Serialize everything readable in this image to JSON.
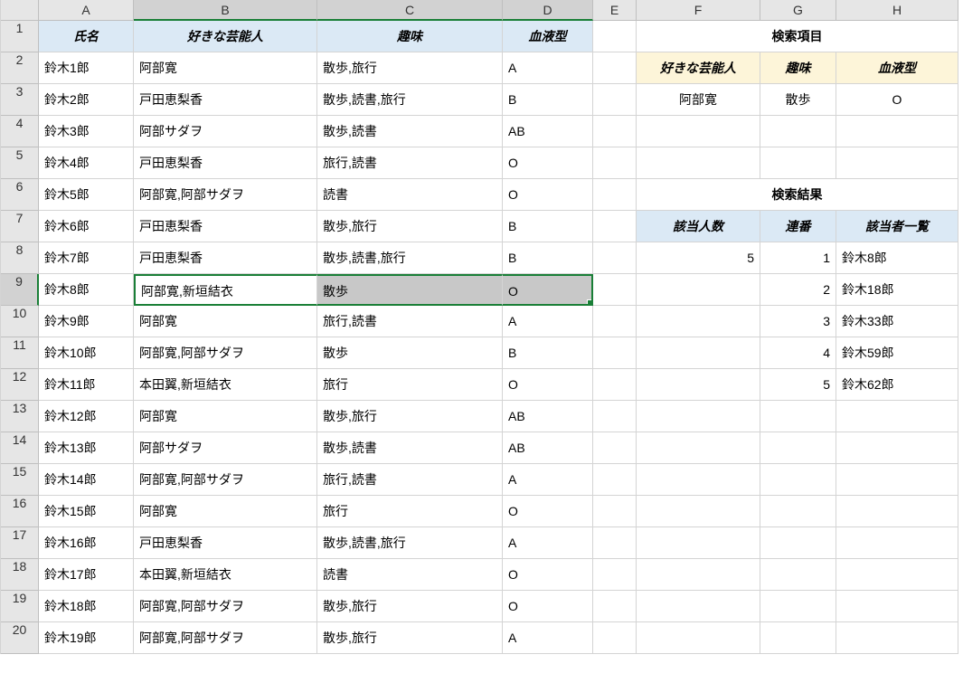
{
  "cols": [
    "A",
    "B",
    "C",
    "D",
    "E",
    "F",
    "G",
    "H"
  ],
  "rows": [
    "1",
    "2",
    "3",
    "4",
    "5",
    "6",
    "7",
    "8",
    "9",
    "10",
    "11",
    "12",
    "13",
    "14",
    "15",
    "16",
    "17",
    "18",
    "19",
    "20"
  ],
  "header": {
    "A": "氏名",
    "B": "好きな芸能人",
    "C": "趣味",
    "D": "血液型"
  },
  "search_section_title": "検索項目",
  "search_header": {
    "F": "好きな芸能人",
    "G": "趣味",
    "H": "血液型"
  },
  "search_values": {
    "F": "阿部寛",
    "G": "散歩",
    "H": "O"
  },
  "result_section_title": "検索結果",
  "result_header": {
    "F": "該当人数",
    "G": "連番",
    "H": "該当者一覧"
  },
  "result_count": "5",
  "results": [
    {
      "no": "1",
      "name": "鈴木8郎"
    },
    {
      "no": "2",
      "name": "鈴木18郎"
    },
    {
      "no": "3",
      "name": "鈴木33郎"
    },
    {
      "no": "4",
      "name": "鈴木59郎"
    },
    {
      "no": "5",
      "name": "鈴木62郎"
    }
  ],
  "data": [
    {
      "A": "鈴木1郎",
      "B": "阿部寛",
      "C": "散歩,旅行",
      "D": "A"
    },
    {
      "A": "鈴木2郎",
      "B": "戸田恵梨香",
      "C": "散歩,読書,旅行",
      "D": "B"
    },
    {
      "A": "鈴木3郎",
      "B": "阿部サダヲ",
      "C": "散歩,読書",
      "D": "AB"
    },
    {
      "A": "鈴木4郎",
      "B": "戸田恵梨香",
      "C": "旅行,読書",
      "D": "O"
    },
    {
      "A": "鈴木5郎",
      "B": "阿部寛,阿部サダヲ",
      "C": "読書",
      "D": "O"
    },
    {
      "A": "鈴木6郎",
      "B": "戸田恵梨香",
      "C": "散歩,旅行",
      "D": "B"
    },
    {
      "A": "鈴木7郎",
      "B": "戸田恵梨香",
      "C": "散歩,読書,旅行",
      "D": "B"
    },
    {
      "A": "鈴木8郎",
      "B": "阿部寛,新垣結衣",
      "C": "散歩",
      "D": "O"
    },
    {
      "A": "鈴木9郎",
      "B": "阿部寛",
      "C": "旅行,読書",
      "D": "A"
    },
    {
      "A": "鈴木10郎",
      "B": "阿部寛,阿部サダヲ",
      "C": "散歩",
      "D": "B"
    },
    {
      "A": "鈴木11郎",
      "B": "本田翼,新垣結衣",
      "C": "旅行",
      "D": "O"
    },
    {
      "A": "鈴木12郎",
      "B": "阿部寛",
      "C": "散歩,旅行",
      "D": "AB"
    },
    {
      "A": "鈴木13郎",
      "B": "阿部サダヲ",
      "C": "散歩,読書",
      "D": "AB"
    },
    {
      "A": "鈴木14郎",
      "B": "阿部寛,阿部サダヲ",
      "C": "旅行,読書",
      "D": "A"
    },
    {
      "A": "鈴木15郎",
      "B": "阿部寛",
      "C": "旅行",
      "D": "O"
    },
    {
      "A": "鈴木16郎",
      "B": "戸田恵梨香",
      "C": "散歩,読書,旅行",
      "D": "A"
    },
    {
      "A": "鈴木17郎",
      "B": "本田翼,新垣結衣",
      "C": "読書",
      "D": "O"
    },
    {
      "A": "鈴木18郎",
      "B": "阿部寛,阿部サダヲ",
      "C": "散歩,旅行",
      "D": "O"
    },
    {
      "A": "鈴木19郎",
      "B": "阿部寛,阿部サダヲ",
      "C": "散歩,旅行",
      "D": "A"
    }
  ]
}
